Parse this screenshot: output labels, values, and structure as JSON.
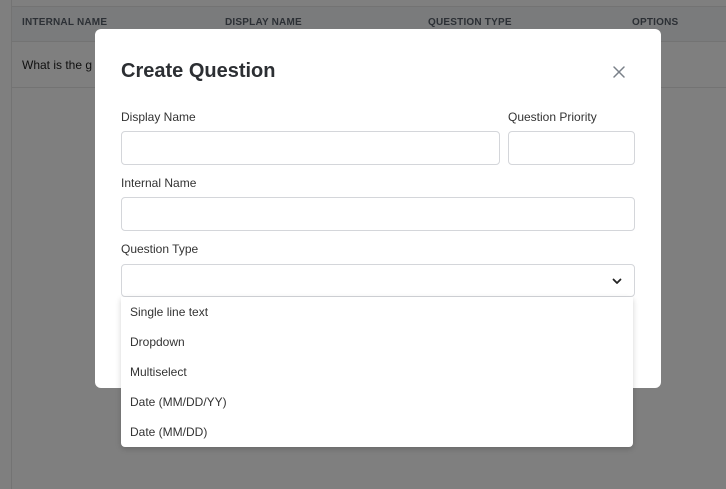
{
  "table": {
    "headers": [
      "INTERNAL NAME",
      "DISPLAY NAME",
      "QUESTION TYPE",
      "OPTIONS"
    ],
    "rows": [
      {
        "internal_name": "What is the g"
      }
    ]
  },
  "modal": {
    "title": "Create Question",
    "fields": {
      "display_name": {
        "label": "Display Name",
        "value": ""
      },
      "question_priority": {
        "label": "Question Priority",
        "value": ""
      },
      "internal_name": {
        "label": "Internal Name",
        "value": ""
      },
      "question_type": {
        "label": "Question Type",
        "selected": ""
      }
    },
    "question_type_options": [
      "Single line text",
      "Dropdown",
      "Multiselect",
      "Date (MM/DD/YY)",
      "Date (MM/DD)"
    ]
  },
  "icons": {
    "close": "close-icon",
    "select_toggle": "chevron-down-icon"
  },
  "colors": {
    "overlay": "#000000",
    "modal_bg": "#ffffff",
    "input_border": "#d4d6da",
    "header_bg": "#f5f6f8"
  }
}
